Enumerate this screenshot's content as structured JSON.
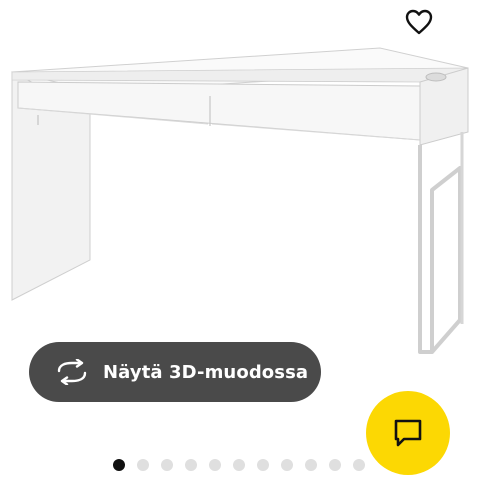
{
  "product": {
    "image_alt": "White desk with two drawers",
    "favorite": {
      "icon": "heart-outline-icon"
    },
    "view_3d": {
      "label": "Näytä 3D-muodossa",
      "icon": "rotate-3d-icon"
    }
  },
  "chat": {
    "icon": "chat-bubble-icon",
    "color": "#fcd803"
  },
  "carousel": {
    "total": 11,
    "active_index": 0
  },
  "colors": {
    "button_dark": "#4a4a4a",
    "accent_yellow": "#fcd803",
    "dot_active": "#111111",
    "dot_inactive": "#dfdfdf"
  }
}
